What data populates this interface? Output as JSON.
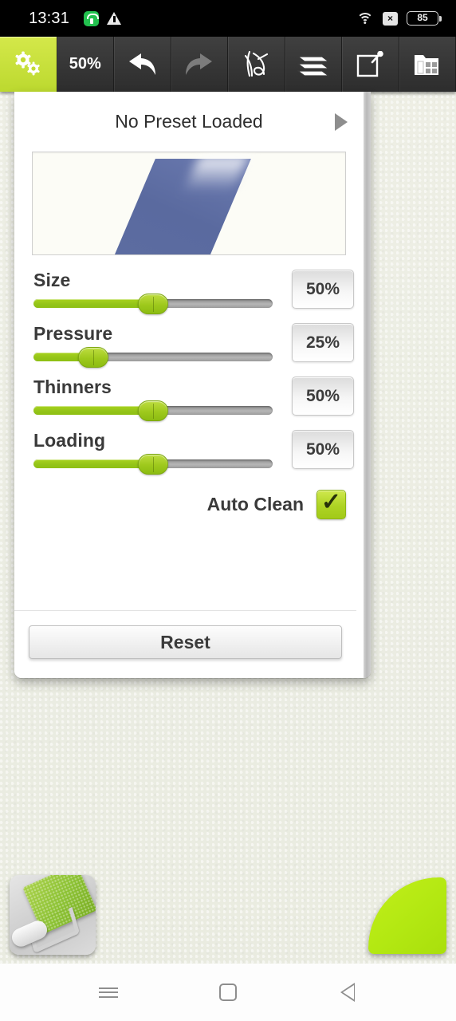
{
  "status_bar": {
    "time": "13:31",
    "left_icons": [
      "health-app-icon",
      "warning-icon"
    ],
    "wifi_icon": "wifi-icon",
    "no_sim_label": "×",
    "battery_level": "85"
  },
  "toolbar": {
    "settings_icon": "gears-icon",
    "zoom_label": "50%",
    "undo_icon": "undo-arrow-icon",
    "redo_icon": "redo-arrow-icon",
    "brush_icon": "paintbrush-icon",
    "layers_icon": "layers-icon",
    "canvas_icon": "new-canvas-icon",
    "gallery_icon": "gallery-folder-icon"
  },
  "panel": {
    "preset_title": "No Preset Loaded",
    "next_preset_icon": "play-triangle-icon",
    "preview_label": "brush-stroke-preview",
    "sliders": [
      {
        "label": "Size",
        "value": "50%",
        "percent": 50
      },
      {
        "label": "Pressure",
        "value": "25%",
        "percent": 25
      },
      {
        "label": "Thinners",
        "value": "50%",
        "percent": 50
      },
      {
        "label": "Loading",
        "value": "50%",
        "percent": 50
      }
    ],
    "auto_clean_label": "Auto Clean",
    "auto_clean_checked": true,
    "reset_label": "Reset"
  },
  "tools": {
    "current_tool_icon": "paint-roller-icon",
    "color_swatch_label": "color-swatch"
  },
  "nav_bar": {
    "menu_icon": "menu-icon",
    "home_icon": "home-icon",
    "back_icon": "back-icon"
  },
  "colors": {
    "accent_green": "#b3e812",
    "toolbar_active": "#c8e23d",
    "slider_fill": "#93c418",
    "stroke_blue": "#5a6a9f",
    "canvas_bg": "#ecede2"
  }
}
